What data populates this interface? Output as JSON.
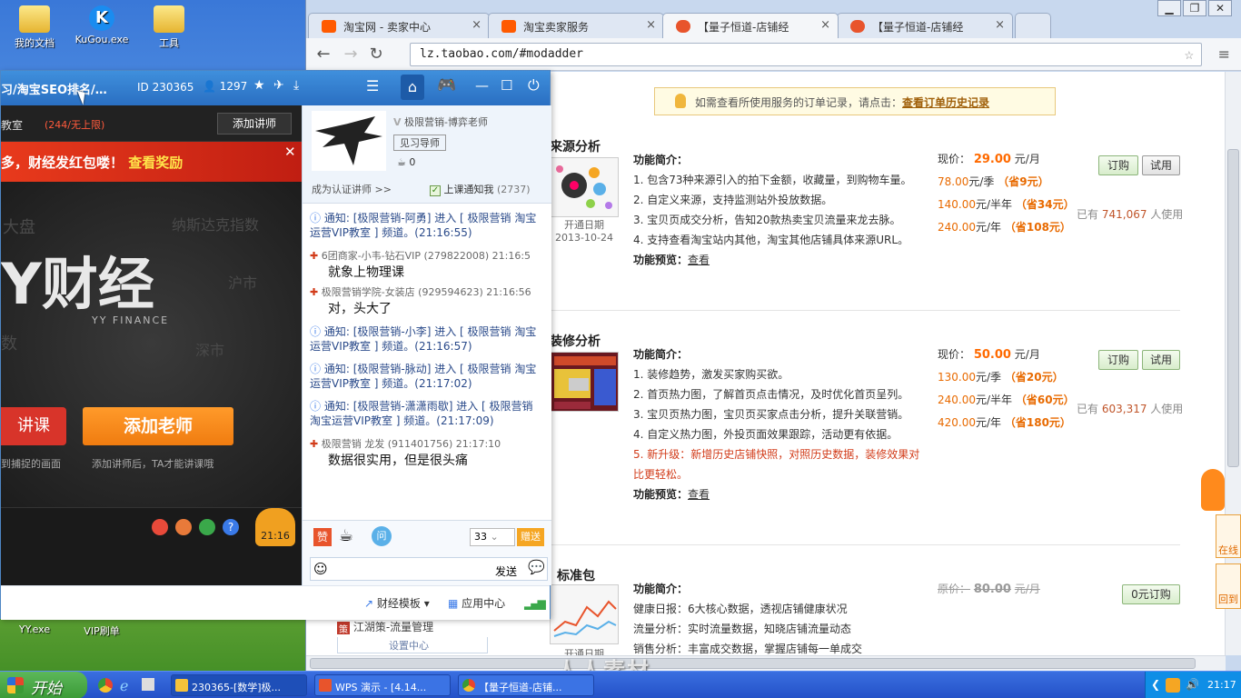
{
  "desktop": {
    "icons": [
      {
        "label": "我的文档"
      },
      {
        "label": "KuGou.exe"
      },
      {
        "label": "工具"
      },
      {
        "label": "YY.exe"
      },
      {
        "label": "VIP刷单"
      }
    ]
  },
  "browser": {
    "tabs": [
      {
        "label": "淘宝网 - 卖家中心"
      },
      {
        "label": "淘宝卖家服务"
      },
      {
        "label": "【量子恒道-店铺经"
      },
      {
        "label": "【量子恒道-店铺经"
      }
    ],
    "url": "lz.taobao.com/#modadder",
    "notice": {
      "text": "如需查看所使用服务的订单记录，请点击：",
      "link": "查看订单历史记录"
    },
    "services": [
      {
        "title": "来源分析",
        "open_label": "开通日期",
        "open_date": "2013-10-24",
        "desc_head": "功能简介：",
        "items": [
          "1. 包含73种来源引入的拍下金额，收藏量，到购物车量。",
          "2. 自定义来源，支持监测站外投放数据。",
          "3. 宝贝页成交分析，告知20款热卖宝贝流量来龙去脉。",
          "4. 支持查看淘宝站内其他，淘宝其他店铺具体来源URL。"
        ],
        "preview_label": "功能预览：",
        "preview_link": "查看",
        "price_label": "现价：",
        "price": "29.00",
        "price_unit": "元/月",
        "plans": [
          {
            "price": "78.00",
            "unit": "元/季",
            "save": "（省9元）"
          },
          {
            "price": "140.00",
            "unit": "元/半年",
            "save": "（省34元）"
          },
          {
            "price": "240.00",
            "unit": "元/年",
            "save": "（省108元）"
          }
        ],
        "users_prefix": "已有",
        "users": "741,067",
        "users_suffix": "人使用",
        "btn_order": "订购",
        "btn_trial": "试用"
      },
      {
        "title": "装修分析",
        "desc_head": "功能简介：",
        "items": [
          "1. 装修趋势，激发买家购买欲。",
          "2. 首页热力图，了解首页点击情况，及时优化首页呈列。",
          "3. 宝贝页热力图，宝贝页买家点击分析，提升关联营销。",
          "4. 自定义热力图，外投页面效果跟踪，活动更有依据。"
        ],
        "item_red": "5. 新升级：新增历史店铺快照，对照历史数据，装修效果对比更轻松。",
        "preview_label": "功能预览：",
        "preview_link": "查看",
        "price_label": "现价：",
        "price": "50.00",
        "price_unit": "元/月",
        "plans": [
          {
            "price": "130.00",
            "unit": "元/季",
            "save": "（省20元）"
          },
          {
            "price": "240.00",
            "unit": "元/半年",
            "save": "（省60元）"
          },
          {
            "price": "420.00",
            "unit": "元/年",
            "save": "（省180元）"
          }
        ],
        "users_prefix": "已有",
        "users": "603,317",
        "users_suffix": "人使用",
        "btn_order": "订购",
        "btn_trial": "试用"
      },
      {
        "title": "标准包",
        "open_label": "开通日期",
        "desc_head": "功能简介：",
        "items": [
          "健康日报：6大核心数据，透视店铺健康状况",
          "流量分析：实时流量数据，知晓店铺流量动态",
          "销售分析：丰富成交数据，掌握店铺每一单成交"
        ],
        "orig_label": "原价：",
        "orig_price": "80.00",
        "orig_unit": "元/月",
        "btn_free": "0元订购"
      }
    ],
    "side_menu": {
      "item": "江湖策-流量管理",
      "sub": "设置中心"
    },
    "float": {
      "online": "在线",
      "back": "回到"
    }
  },
  "yy": {
    "title": "习/淘宝SEO排名/…",
    "id_label": "ID 230365",
    "members": "1297",
    "room_label": "教室",
    "room_count": "(244/无上限)",
    "add_teacher_btn": "添加讲师",
    "banner": "多，财经发红包喽！",
    "banner_link": "查看奖励",
    "logo_main": "Y财经",
    "logo_sub": "YY FINANCE",
    "bg_words": [
      "大盘",
      "纳斯达克指数",
      "沪市",
      "数",
      "深市"
    ],
    "btn_lecture": "讲课",
    "btn_add_teacher": "添加老师",
    "hint_left": "到捕捉的画面",
    "hint_right": "添加讲师后，TA才能讲课哦",
    "clock": "21:16",
    "teacher": {
      "name": "极限营销-博弈老师",
      "badge": "见习导师",
      "flowers": "0",
      "certify": "成为认证讲师 >>",
      "notify": "上课通知我",
      "notify_count": "(2737)"
    },
    "chat": [
      {
        "kind": "notice",
        "text": "通知: [极限营销-阿勇] 进入 [ 极限营销 淘宝运营VIP教室 ] 频道。(21:16:55)"
      },
      {
        "kind": "msg",
        "name": "6团商家-小韦-钻石VIP (279822008) 21:16:5",
        "text": "就象上物理课"
      },
      {
        "kind": "msg",
        "name": "极限营销学院-女装店 (929594623) 21:16:56",
        "text": "对，头大了"
      },
      {
        "kind": "notice",
        "text": "通知: [极限营销-小李] 进入 [ 极限营销 淘宝运营VIP教室 ] 频道。(21:16:57)"
      },
      {
        "kind": "notice",
        "text": "通知: [极限营销-脉动] 进入 [ 极限营销 淘宝运营VIP教室 ] 频道。(21:17:02)"
      },
      {
        "kind": "notice",
        "text": "通知: [极限营销-潇潇雨歇] 进入 [ 极限营销 淘宝运营VIP教室 ] 频道。(21:17:09)"
      },
      {
        "kind": "msg",
        "name": "极限营销 龙发 (911401756) 21:17:10",
        "text": "数据很实用，但是很头痛"
      }
    ],
    "gift_count": "33",
    "gift_btn": "赠送",
    "send_btn": "发送",
    "bottom": {
      "finance": "财经模板",
      "apps": "应用中心"
    }
  },
  "taskbar": {
    "start": "开始",
    "tasks": [
      {
        "label": "230365-[数学]极..."
      },
      {
        "label": "WPS 演示 - [4.14..."
      },
      {
        "label": "【量子恒道-店铺..."
      }
    ],
    "time": "21:17"
  },
  "watermark": "人人素材"
}
